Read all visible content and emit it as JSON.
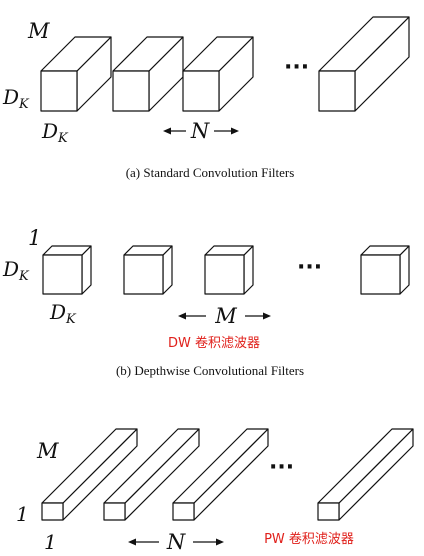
{
  "panel_a": {
    "depth_label": "M",
    "height_label": "D",
    "height_sub": "K",
    "width_label": "D",
    "width_sub": "K",
    "count_label": "N",
    "ellipsis": "···",
    "caption": "(a)  Standard Convolution Filters"
  },
  "panel_b": {
    "depth_label": "1",
    "height_label": "D",
    "height_sub": "K",
    "width_label": "D",
    "width_sub": "K",
    "count_label": "M",
    "ellipsis": "···",
    "note": "DW 卷积滤波器",
    "caption": "(b)  Depthwise Convolutional Filters"
  },
  "panel_c": {
    "depth_label": "M",
    "height_label": "1",
    "width_label": "1",
    "count_label": "N",
    "ellipsis": "···",
    "note": "PW 卷积滤波器"
  },
  "colors": {
    "stroke": "#111111",
    "note": "#e0201b"
  }
}
